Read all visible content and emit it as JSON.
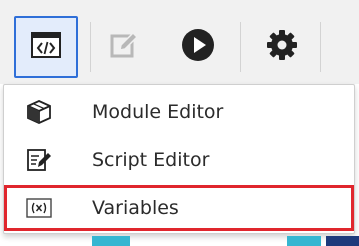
{
  "toolbar": {
    "buttons": [
      {
        "name": "code-editor-toggle",
        "icon": "code-window-icon",
        "active": true
      },
      {
        "name": "edit",
        "icon": "edit-pencil-icon",
        "active": false
      },
      {
        "name": "run",
        "icon": "play-circle-icon",
        "active": false
      },
      {
        "name": "settings",
        "icon": "gear-icon",
        "active": false
      }
    ]
  },
  "menu": {
    "items": [
      {
        "label": "Module Editor",
        "icon": "cube-icon"
      },
      {
        "label": "Script Editor",
        "icon": "script-pen-icon"
      },
      {
        "label": "Variables",
        "icon": "variable-x-icon",
        "highlighted": true
      }
    ]
  },
  "colors": {
    "accent": "#2f6fd8",
    "highlight_border": "#e0262d",
    "toolbar_bg": "#f1f1f1",
    "strip_teal": "#35b6d1",
    "strip_navy": "#1e3a7c"
  }
}
